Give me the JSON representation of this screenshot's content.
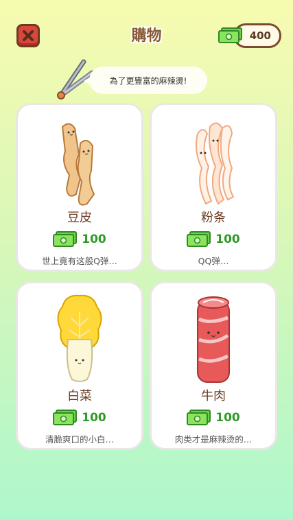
{
  "header": {
    "title": "購物",
    "close_icon": "close-x-icon"
  },
  "wallet": {
    "amount": "400",
    "icon": "cash-icon"
  },
  "tip": {
    "text": "為了更豐富的麻辣燙!"
  },
  "items": [
    {
      "name": "豆皮",
      "price": "100",
      "desc": "世上竟有这般Q弹…",
      "icon": "tofu-skin-icon"
    },
    {
      "name": "粉条",
      "price": "100",
      "desc": "QQ弹…",
      "icon": "noodle-icon"
    },
    {
      "name": "白菜",
      "price": "100",
      "desc": "清脆爽口的小白…",
      "icon": "cabbage-icon"
    },
    {
      "name": "牛肉",
      "price": "100",
      "desc": "肉类才是麻辣烫的…",
      "icon": "beef-roll-icon"
    }
  ],
  "colors": {
    "price": "#2f9a28",
    "close": "#d9473a",
    "title": "#8a5a35"
  }
}
